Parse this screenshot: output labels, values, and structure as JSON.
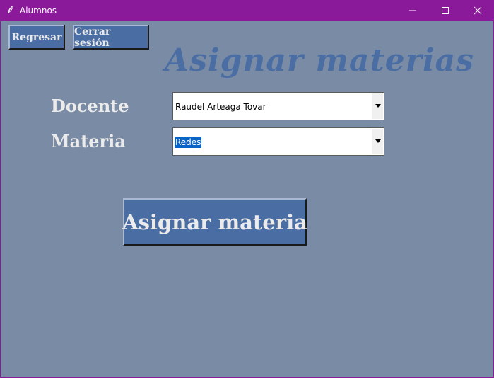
{
  "window": {
    "title": "Alumnos",
    "app_icon": "feather-icon",
    "controls": [
      "minimize-icon",
      "maximize-icon",
      "close-icon"
    ]
  },
  "toolbar": {
    "back_label": "Regresar",
    "logout_label": "Cerrar sesión"
  },
  "page": {
    "heading": "Asignar materias"
  },
  "form": {
    "docente_label": "Docente",
    "docente_value": "Raudel Arteaga Tovar",
    "materia_label": "Materia",
    "materia_value": "Redes",
    "submit_label": "Asignar materia"
  },
  "colors": {
    "titlebar": "#8a1a9a",
    "background": "#7a8ba5",
    "accent": "#4a6ea4",
    "selection": "#0a64c8"
  }
}
